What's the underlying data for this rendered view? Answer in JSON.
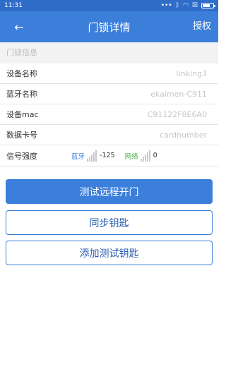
{
  "status_bar": {
    "time": "11:31",
    "icons": [
      "dots-icon",
      "bluetooth-icon",
      "wifi-icon",
      "sim-x-icon",
      "battery-icon"
    ]
  },
  "header": {
    "back_icon": "←",
    "title": "门锁详情",
    "action_label": "授权"
  },
  "section": {
    "title": "门锁信息"
  },
  "info_rows": [
    {
      "label": "设备名称",
      "value": "linking3"
    },
    {
      "label": "蓝牙名称",
      "value": "ekaimen-C911"
    },
    {
      "label": "设备mac",
      "value": "C91122F8E6A0"
    },
    {
      "label": "数据卡号",
      "value": "cardnumber"
    }
  ],
  "signal": {
    "label": "信号强度",
    "bluetooth_label": "蓝牙",
    "bluetooth_value": "-125",
    "network_label": "网络",
    "network_value": "0"
  },
  "buttons": {
    "remote_open": "测试远程开门",
    "sync_keys": "同步钥匙",
    "add_test_key": "添加测试钥匙"
  },
  "colors": {
    "header_bg": "#3b7fdb",
    "status_bg": "#2f6dc9",
    "bluetooth_text": "#3b7fdb",
    "network_text": "#4caf50"
  }
}
